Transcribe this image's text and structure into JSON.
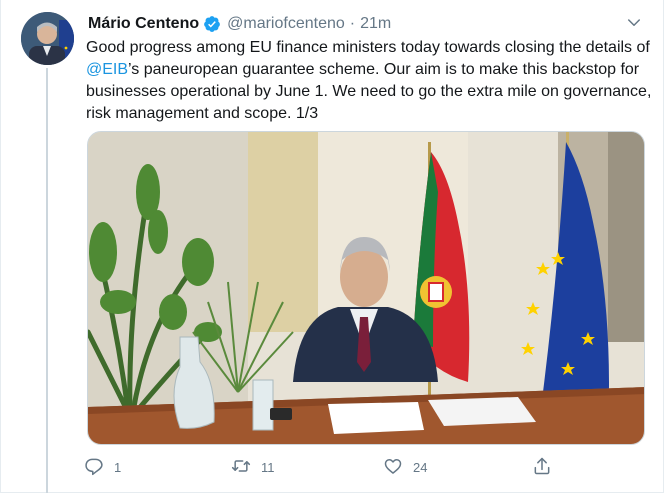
{
  "tweet": {
    "author": {
      "name": "Mário Centeno",
      "handle": "@mariofcenteno",
      "verified": true
    },
    "time": "21m",
    "separator": "·",
    "text_before": "Good progress among EU finance ministers today towards closing the details of ",
    "mention": "@EIB",
    "text_after": "’s paneuropean guarantee scheme. Our aim is to make this backstop for businesses operational by June 1. We need to go the extra mile on governance, risk management and scope. 1/3",
    "media": {
      "type": "photo"
    },
    "actions": {
      "reply_count": "1",
      "retweet_count": "11",
      "like_count": "24"
    }
  },
  "colors": {
    "accent": "#1da1f2",
    "mention": "#1b95e0",
    "secondary_text": "#657786",
    "border": "#e6ecf0"
  },
  "icons": [
    "verified-icon",
    "chevron-down-icon",
    "reply-icon",
    "retweet-icon",
    "like-icon",
    "share-icon"
  ]
}
